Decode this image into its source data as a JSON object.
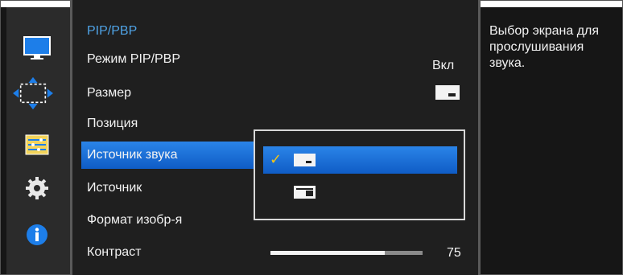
{
  "nav": {
    "items": [
      {
        "name": "picture",
        "icon": "monitor-icon"
      },
      {
        "name": "onscreen-display",
        "icon": "move-arrows-icon"
      },
      {
        "name": "system",
        "icon": "settings-panel-icon"
      },
      {
        "name": "settings",
        "icon": "gear-icon"
      },
      {
        "name": "information",
        "icon": "info-icon"
      }
    ]
  },
  "menu": {
    "title": "PIP/PBP",
    "items": [
      {
        "label": "Режим PIP/PBP",
        "value": "Вкл"
      },
      {
        "label": "Размер",
        "value_icon": "pip-size-icon"
      },
      {
        "label": "Позиция"
      },
      {
        "label": "Источник звука",
        "selected": true
      },
      {
        "label": "Источник"
      },
      {
        "label": "Формат изобр-я"
      },
      {
        "label": "Контраст",
        "value": "75",
        "slider_level_percent": 75
      }
    ]
  },
  "dropdown": {
    "options": [
      {
        "icon": "main-screen-audio-icon",
        "checked": true
      },
      {
        "icon": "sub-screen-audio-icon",
        "checked": false
      }
    ],
    "check_glyph": "✓"
  },
  "help": {
    "text": "Выбор экрана для прослушивания звука."
  },
  "colors": {
    "accent_blue": "#1a6fd6",
    "title_blue": "#4fa3e6",
    "check_yellow": "#f2c418"
  }
}
